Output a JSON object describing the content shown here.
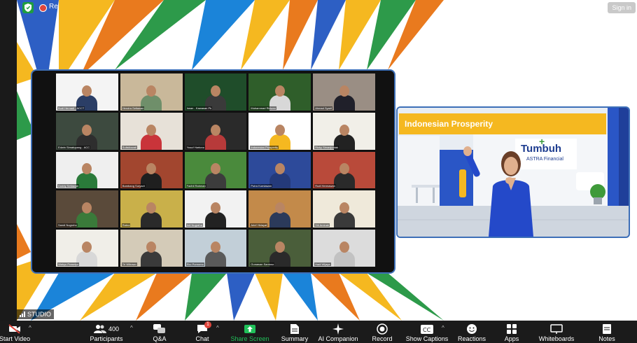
{
  "top": {
    "recording_label": "Re",
    "sign_in": "Sign in"
  },
  "presenter": {
    "banner": "Indonesian Prosperity",
    "logo_main": "Tumbuh",
    "logo_sub": "ASTRA Financial"
  },
  "studio_label": "STUDIO",
  "toolbar": {
    "start_video": "Start Video",
    "participants": "Participants",
    "participants_count": "400",
    "qa": "Q&A",
    "chat": "Chat",
    "chat_badge": "1",
    "share_screen": "Share Screen",
    "summary": "Summary",
    "ai_companion": "AI Companion",
    "record": "Record",
    "show_captions": "Show Captions",
    "reactions": "Reactions",
    "apps": "Apps",
    "whiteboards": "Whiteboards",
    "notes": "Notes"
  },
  "colors": {
    "accent_green": "#1f9d3f",
    "brand_yellow": "#f5b820",
    "brand_blue": "#2a56c6",
    "toolbar_bg": "#1b1b1b"
  },
  "gallery": {
    "tiles": [
      {
        "name": "Budi Hernadi - ACCT",
        "bg": "#f4f4f4",
        "shirt": "#2b3e66"
      },
      {
        "name": "Hendra Setiawan",
        "bg": "#c9b89a",
        "shirt": "#6f8f6a"
      },
      {
        "name": "Irwan - Kawasan Pk",
        "bg": "#1f4d2a",
        "shirt": "#3a3a3a"
      },
      {
        "name": "Muhammad Ridwan",
        "bg": "#2f5e2a",
        "shirt": "#d8d8d8"
      },
      {
        "name": "Ahmad Syarif",
        "bg": "#9a8e84",
        "shirt": "#20202a"
      },
      {
        "name": "Edwin Simatupang - ACC",
        "bg": "#3d4a3f",
        "shirt": "#2e2e2e"
      },
      {
        "name": "Sulistiowati",
        "bg": "#e7e1d8",
        "shirt": "#c9343a"
      },
      {
        "name": "Yusuf Hartono",
        "bg": "#2a2a2a",
        "shirt": "#b73a3a"
      },
      {
        "name": "Indonesian Prosperity",
        "bg": "#ffffff",
        "shirt": "#f5b820"
      },
      {
        "name": "Ricky Simanjuntak",
        "bg": "#f1efe8",
        "shirt": "#222"
      },
      {
        "name": "Doddy Setiawan",
        "bg": "#efefef",
        "shirt": "#2a7a3a"
      },
      {
        "name": "Bambang Suryadi",
        "bg": "#a2462f",
        "shirt": "#1f1f1f"
      },
      {
        "name": "Fadhil Rahman",
        "bg": "#4a8a3c",
        "shirt": "#3c3c3c"
      },
      {
        "name": "Putra Kurniawan",
        "bg": "#2d4a9a",
        "shirt": "#243a7a"
      },
      {
        "name": "Rudi Hermawan",
        "bg": "#b94a3a",
        "shirt": "#2a2a2a"
      },
      {
        "name": "Sandi Nugroho",
        "bg": "#5a4a3a",
        "shirt": "#3a7a3a"
      },
      {
        "name": "Ratna",
        "bg": "#c9b04a",
        "shirt": "#2a2a2a"
      },
      {
        "name": "Adi Nugraha",
        "bg": "#f2f2f2",
        "shirt": "#222"
      },
      {
        "name": "Arief Hidayat",
        "bg": "#c38a4a",
        "shirt": "#2b3a5a"
      },
      {
        "name": "Siti Aminah",
        "bg": "#efe9da",
        "shirt": "#3a3a3a"
      },
      {
        "name": "Wahyu Prasetyo",
        "bg": "#f0eee8",
        "shirt": "#d8d8d8"
      },
      {
        "name": "Tri Wibowo",
        "bg": "#d4cbb8",
        "shirt": "#3a3a3a"
      },
      {
        "name": "Eko Purnomo",
        "bg": "#c2cfd8",
        "shirt": "#5a5a5a"
      },
      {
        "name": "Gunawan Santoso",
        "bg": "#4a5e3a",
        "shirt": "#2a2a2a"
      },
      {
        "name": "Hadi Wijaya",
        "bg": "#dcdcdc",
        "shirt": "#c2c2c2"
      }
    ]
  }
}
